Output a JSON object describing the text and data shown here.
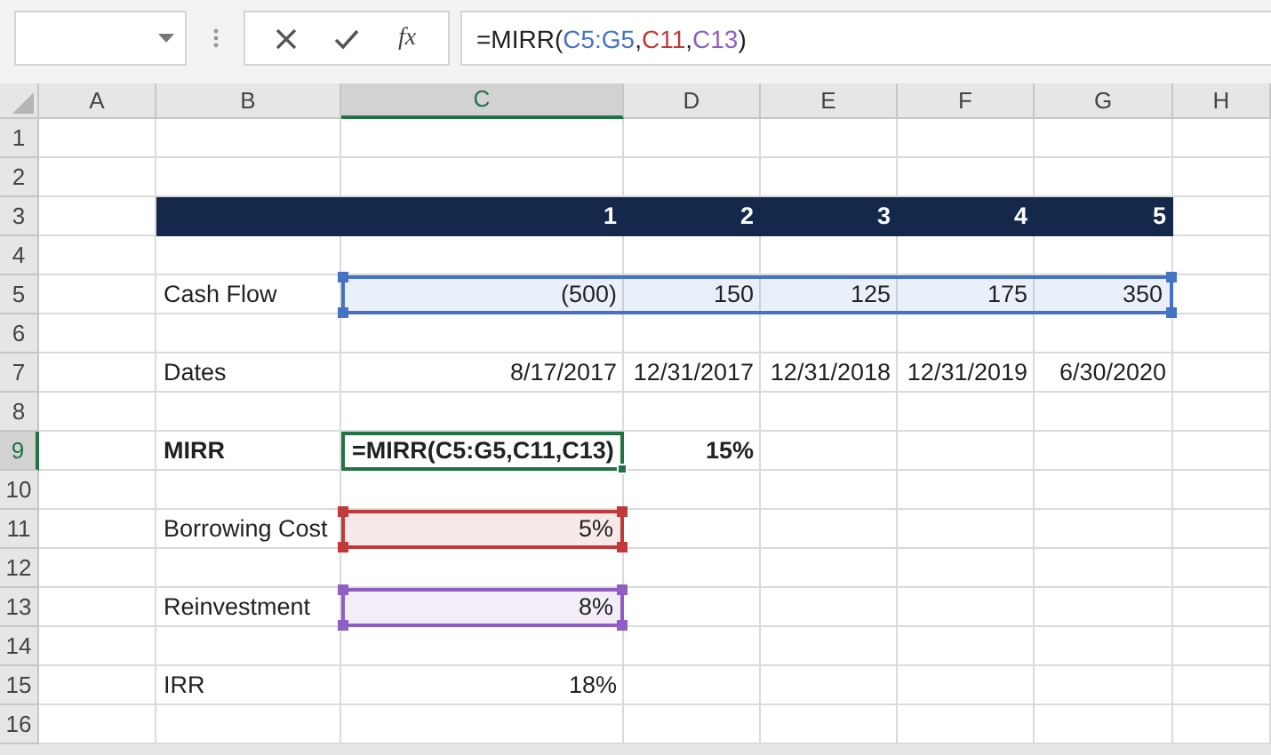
{
  "formula_bar": {
    "function_button": "fx",
    "formula": [
      {
        "text": "=MIRR(",
        "color": "#222222"
      },
      {
        "text": "C5:G5",
        "color": "#4472c4"
      },
      {
        "separator": ",",
        "text": "C11",
        "color": "#c0393b"
      },
      {
        "separator": ",",
        "text": "C13",
        "color": "#8e5ec3"
      },
      {
        "text": ")",
        "color": "#222222"
      }
    ]
  },
  "columns": [
    {
      "label": "A",
      "selected": false
    },
    {
      "label": "B",
      "selected": false
    },
    {
      "label": "C",
      "selected": true
    },
    {
      "label": "D",
      "selected": false
    },
    {
      "label": "E",
      "selected": false
    },
    {
      "label": "F",
      "selected": false
    },
    {
      "label": "G",
      "selected": false
    },
    {
      "label": "H",
      "selected": false
    }
  ],
  "rows": [
    {
      "number": "1",
      "selected": false,
      "kind": "plain",
      "cells": {}
    },
    {
      "number": "2",
      "selected": false,
      "kind": "plain",
      "cells": {}
    },
    {
      "number": "3",
      "selected": false,
      "kind": "band",
      "cells": {
        "C": {
          "text": "1",
          "kind": "number",
          "bold": true,
          "selected": false
        },
        "D": {
          "text": "2",
          "kind": "number",
          "bold": true,
          "selected": false
        },
        "E": {
          "text": "3",
          "kind": "number",
          "bold": true,
          "selected": false
        },
        "F": {
          "text": "4",
          "kind": "number",
          "bold": true,
          "selected": false
        },
        "G": {
          "text": "5",
          "kind": "number",
          "bold": true,
          "selected": false
        }
      }
    },
    {
      "number": "4",
      "selected": false,
      "kind": "plain",
      "cells": {}
    },
    {
      "number": "5",
      "selected": false,
      "kind": "plain",
      "cells": {
        "B": {
          "text": "Cash Flow",
          "kind": "label",
          "bold": false,
          "selected": false
        },
        "C": {
          "text": "(500)",
          "kind": "number",
          "bold": false,
          "selected": false,
          "color": "#4472c4"
        },
        "D": {
          "text": "150",
          "kind": "number",
          "bold": false,
          "selected": false,
          "color": "#4472c4"
        },
        "E": {
          "text": "125",
          "kind": "number",
          "bold": false,
          "selected": false,
          "color": "#4472c4"
        },
        "F": {
          "text": "175",
          "kind": "number",
          "bold": false,
          "selected": false,
          "color": "#4472c4"
        },
        "G": {
          "text": "350",
          "kind": "number",
          "bold": false,
          "selected": false,
          "color": "#4472c4"
        }
      }
    },
    {
      "number": "6",
      "selected": false,
      "kind": "plain",
      "cells": {}
    },
    {
      "number": "7",
      "selected": false,
      "kind": "plain",
      "cells": {
        "B": {
          "text": "Dates",
          "kind": "label",
          "bold": false,
          "selected": false
        },
        "C": {
          "text": "8/17/2017",
          "kind": "number",
          "bold": false,
          "selected": false
        },
        "D": {
          "text": "12/31/2017",
          "kind": "number",
          "bold": false,
          "selected": false
        },
        "E": {
          "text": "12/31/2018",
          "kind": "number",
          "bold": false,
          "selected": false
        },
        "F": {
          "text": "12/31/2019",
          "kind": "number",
          "bold": false,
          "selected": false
        },
        "G": {
          "text": "6/30/2020",
          "kind": "number",
          "bold": false,
          "selected": false
        }
      }
    },
    {
      "number": "8",
      "selected": false,
      "kind": "plain",
      "cells": {}
    },
    {
      "number": "9",
      "selected": true,
      "kind": "plain",
      "cells": {
        "B": {
          "text": "MIRR",
          "kind": "label",
          "bold": true,
          "selected": false
        },
        "C": {
          "text": "=MIRR(C5:G5,C11,C13)",
          "kind": "label",
          "bold": true,
          "selected": true
        },
        "D": {
          "text": "15%",
          "kind": "number",
          "bold": true,
          "selected": false
        }
      }
    },
    {
      "number": "10",
      "selected": false,
      "kind": "plain",
      "cells": {}
    },
    {
      "number": "11",
      "selected": false,
      "kind": "plain",
      "cells": {
        "B": {
          "text": "Borrowing Cost",
          "kind": "label",
          "bold": false,
          "selected": false
        },
        "C": {
          "text": "5%",
          "kind": "number",
          "bold": false,
          "selected": false,
          "color": "#c0393b"
        }
      }
    },
    {
      "number": "12",
      "selected": false,
      "kind": "plain",
      "cells": {}
    },
    {
      "number": "13",
      "selected": false,
      "kind": "plain",
      "cells": {
        "B": {
          "text": "Reinvestment",
          "kind": "label",
          "bold": false,
          "selected": false
        },
        "C": {
          "text": "8%",
          "kind": "number",
          "bold": false,
          "selected": false,
          "color": "#8e5ec3"
        }
      }
    },
    {
      "number": "14",
      "selected": false,
      "kind": "plain",
      "cells": {}
    },
    {
      "number": "15",
      "selected": false,
      "kind": "plain",
      "cells": {
        "B": {
          "text": "IRR",
          "kind": "label",
          "bold": false,
          "selected": false
        },
        "C": {
          "text": "18%",
          "kind": "number",
          "bold": false,
          "selected": false
        }
      }
    },
    {
      "number": "16",
      "selected": false,
      "kind": "plain",
      "cells": {}
    }
  ]
}
